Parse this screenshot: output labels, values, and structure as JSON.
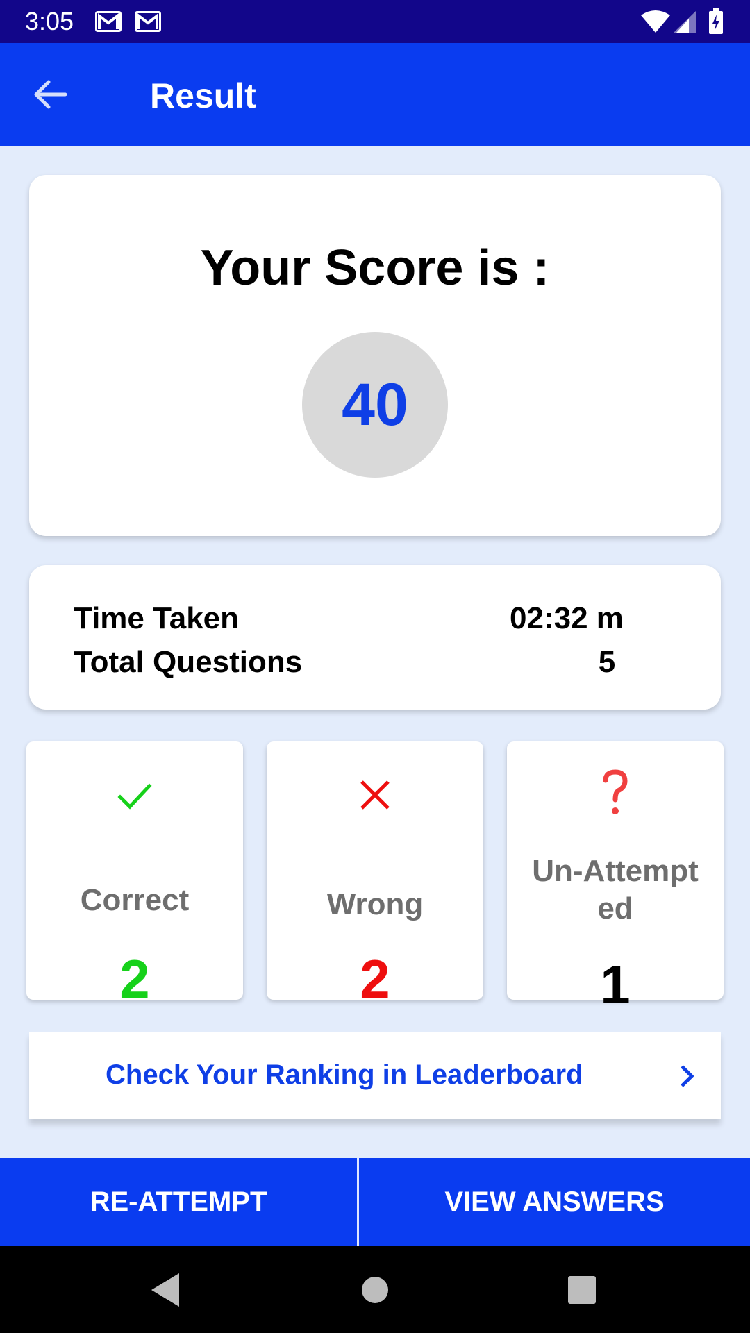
{
  "status_bar": {
    "time": "3:05",
    "icons": [
      "gmail-icon",
      "gmail-icon",
      "wifi-icon",
      "signal-icon",
      "battery-charging-icon"
    ]
  },
  "app_bar": {
    "title": "Result",
    "back_icon": "arrow-back-icon",
    "color": "#0a3cf0"
  },
  "score": {
    "heading": "Your Score is :",
    "value": "40",
    "value_color": "#0f3fe6"
  },
  "summary": {
    "time_label": "Time Taken",
    "time_value": "02:32 m",
    "questions_label": "Total Questions",
    "questions_value": "5"
  },
  "stats": {
    "correct": {
      "label": "Correct",
      "count": "2",
      "icon": "check-icon",
      "color": "#16d11a"
    },
    "wrong": {
      "label": "Wrong",
      "count": "2",
      "icon": "cross-icon",
      "color": "#ee0f0f"
    },
    "unattempted": {
      "label_line1": "Un-Attempt",
      "label_line2": "ed",
      "count": "1",
      "icon": "question-icon",
      "color": "#f04040"
    }
  },
  "leaderboard": {
    "label": "Check Your Ranking in Leaderboard",
    "icon": "chevron-right-icon"
  },
  "actions": {
    "reattempt": "RE-ATTEMPT",
    "view_answers": "VIEW ANSWERS"
  },
  "nav_bar": {
    "icons": [
      "back-triangle-icon",
      "home-circle-icon",
      "recents-square-icon"
    ]
  }
}
